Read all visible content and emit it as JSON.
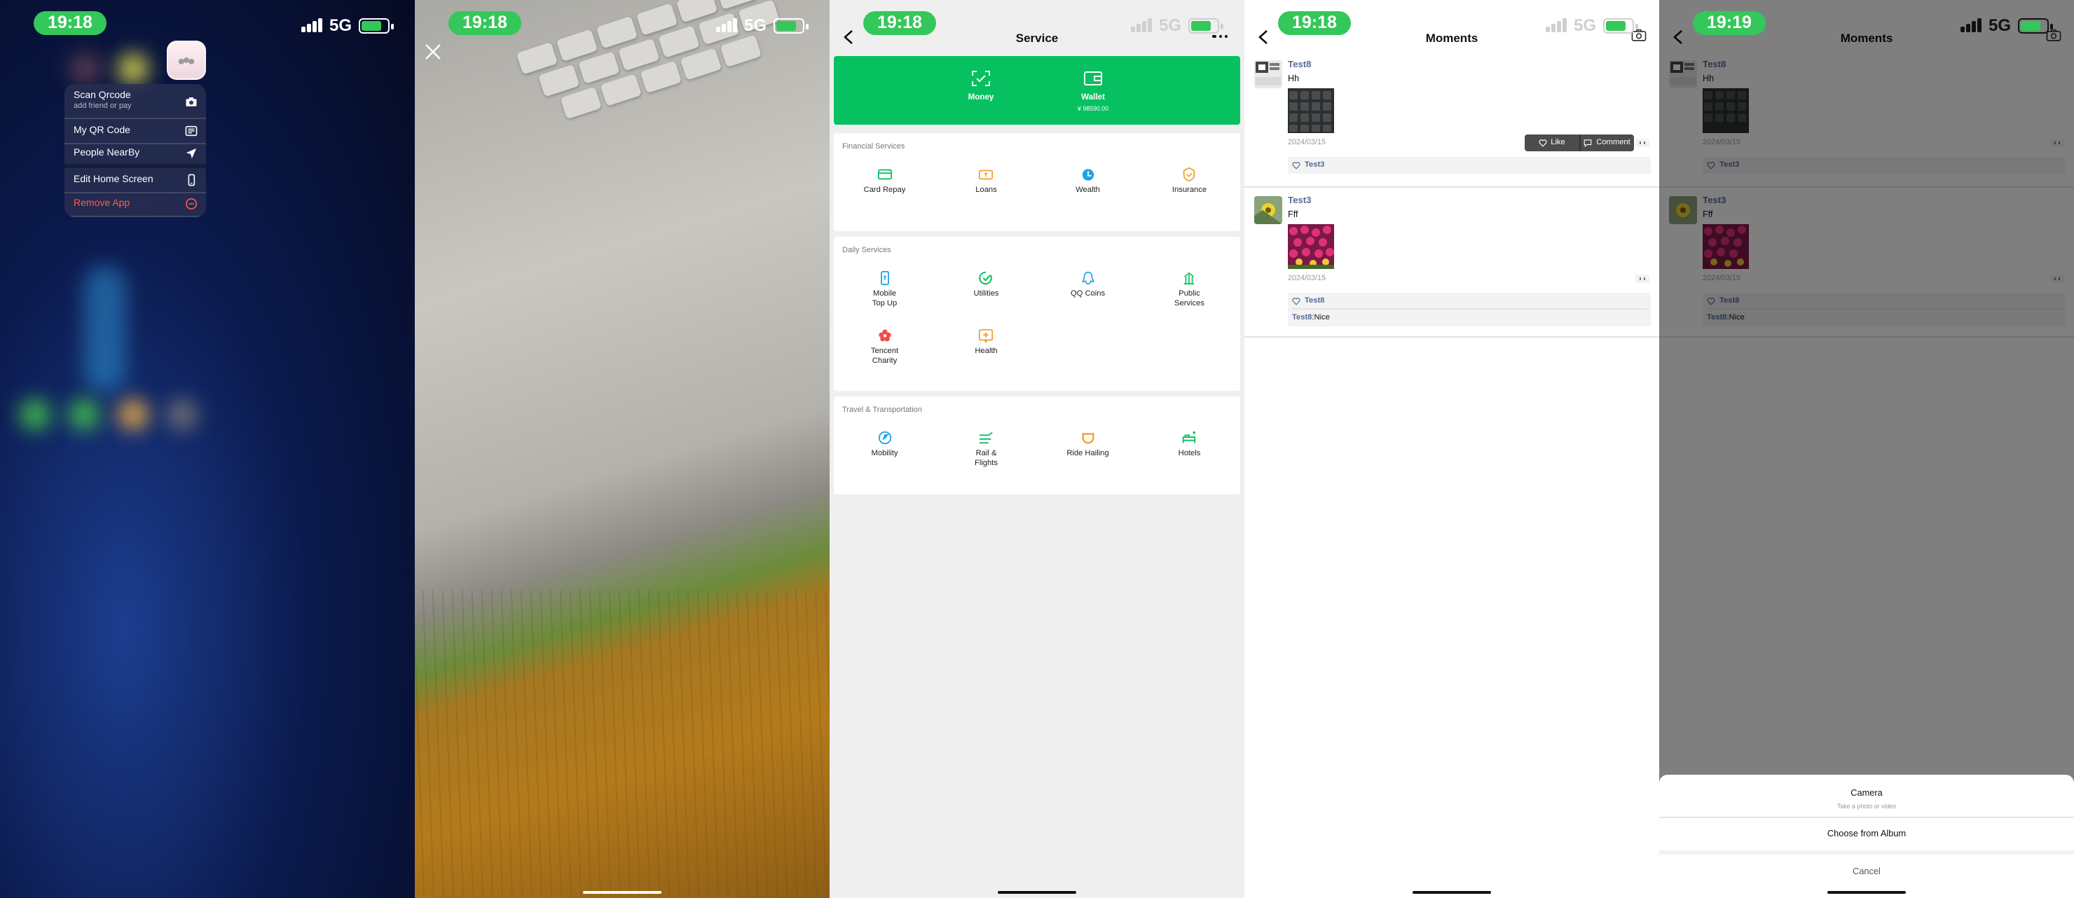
{
  "panel1": {
    "status": {
      "time": "19:18",
      "network": "5G"
    },
    "menu": [
      {
        "label": "Scan Qrcode",
        "sub": "add friend or pay",
        "icon": "camera-icon"
      },
      {
        "label": "My QR Code",
        "icon": "qr-code-icon"
      },
      {
        "label": "People NearBy",
        "icon": "location-arrow-icon"
      },
      {
        "label": "Edit Home Screen",
        "icon": "phone-icon"
      },
      {
        "label": "Remove App",
        "icon": "remove-circle-icon",
        "color": "#ff5a52"
      }
    ]
  },
  "panel2": {
    "status": {
      "time": "19:18",
      "network": "5G"
    }
  },
  "panel3": {
    "status": {
      "time": "19:18",
      "network": "5G"
    },
    "title": "Service",
    "wallet_card": {
      "money_label": "Money",
      "wallet_label": "Wallet",
      "wallet_balance": "¥ 98590.00",
      "color": "#07c160"
    },
    "financial": {
      "title": "Financial Services",
      "items": [
        "Card Repay",
        "Loans",
        "Wealth",
        "Insurance"
      ]
    },
    "daily": {
      "title": "Daily Services",
      "items": [
        "Mobile\nTop Up",
        "Utilities",
        "QQ Coins",
        "Public\nServices",
        "Tencent\nCharity",
        "Health"
      ]
    },
    "travel": {
      "title": "Travel & Transportation",
      "items": [
        "Mobility",
        "Rail &\nFlights",
        "Ride Hailing",
        "Hotels"
      ]
    }
  },
  "panel4": {
    "status": {
      "time": "19:18",
      "network": "5G"
    },
    "title": "Moments",
    "posts": [
      {
        "author": "Test8",
        "text": "Hh",
        "date": "2024/03/15",
        "likes": "Test3"
      },
      {
        "author": "Test3",
        "text": "Fff",
        "date": "2024/03/15",
        "likes": "Test8",
        "comment_author": "Test8",
        "comment_text": ":Nice"
      }
    ],
    "popup": {
      "like": "Like",
      "comment": "Comment"
    }
  },
  "panel5": {
    "status": {
      "time": "19:19",
      "network": "5G"
    },
    "title": "Moments",
    "sheet": {
      "camera": "Camera",
      "camera_sub": "Take a photo or video",
      "album": "Choose from Album",
      "cancel": "Cancel"
    }
  },
  "colors": {
    "accent_green": "#07c160",
    "link_blue": "#576b95",
    "status_green": "#34c759"
  }
}
